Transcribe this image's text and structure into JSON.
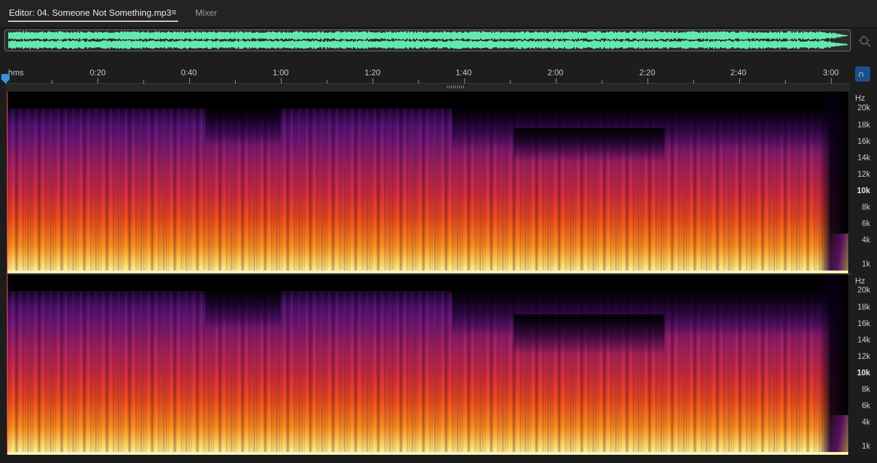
{
  "tabs": {
    "editor_label": "Editor: 04. Someone Not Something.mp3",
    "menu_glyph": "≡",
    "mixer_label": "Mixer"
  },
  "overview": {
    "waveform_color": "#63e8b0"
  },
  "timeline": {
    "unit_label": "hms",
    "labels": [
      "0:20",
      "0:40",
      "1:00",
      "1:20",
      "1:40",
      "2:00",
      "2:20",
      "2:40",
      "3:00"
    ]
  },
  "snap_button": {
    "glyph": "∩"
  },
  "channels": [
    {
      "axis_unit": "Hz",
      "freq_labels": [
        "20k",
        "18k",
        "16k",
        "14k",
        "12k",
        "10k",
        "8k",
        "6k",
        "4k",
        "1k"
      ]
    },
    {
      "axis_unit": "Hz",
      "freq_labels": [
        "20k",
        "18k",
        "16k",
        "14k",
        "12k",
        "10k",
        "8k",
        "6k",
        "4k",
        "1k"
      ]
    }
  ],
  "colors": {
    "playhead": "#3b8fe0",
    "spectrum_low": "#fff5b8",
    "spectrum_mid": "#ec4a1e",
    "spectrum_high": "#4e1070"
  },
  "icons": {
    "menu": "hamburger-menu-icon",
    "zoom": "zoom-to-fit-icon",
    "snap": "magnet-snap-icon",
    "playhead": "playhead-marker-icon"
  }
}
